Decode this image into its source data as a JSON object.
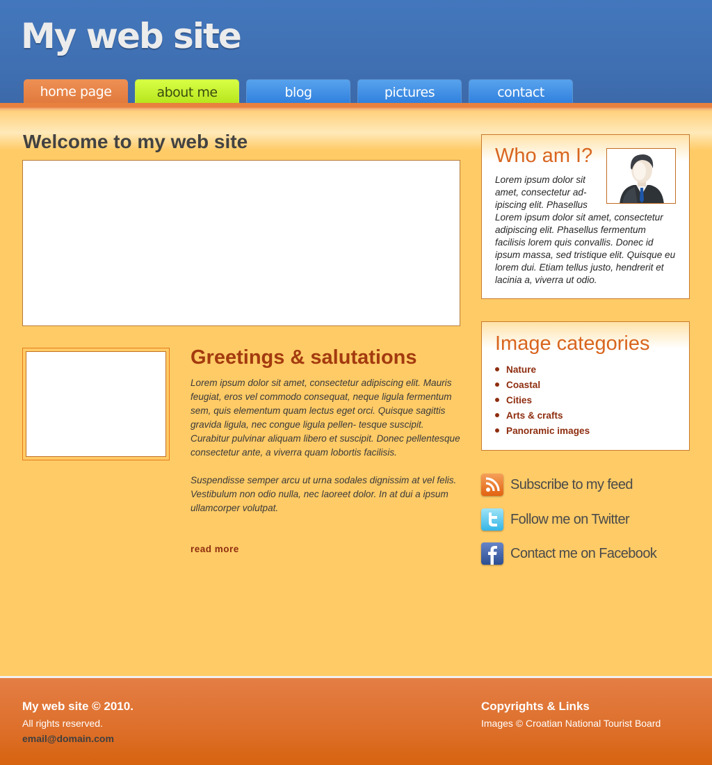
{
  "header": {
    "site_title": "My web site"
  },
  "nav": {
    "tabs": [
      {
        "label": "home page",
        "state": "active"
      },
      {
        "label": "about me"
      },
      {
        "label": "blog"
      },
      {
        "label": "pictures"
      },
      {
        "label": "contact"
      }
    ]
  },
  "main": {
    "welcome_title": "Welcome to my web site",
    "greetings": {
      "title": "Greetings & salutations",
      "paragraph1": "Lorem ipsum dolor sit amet, consectetur adipiscing elit. Mauris feugiat, eros vel commodo consequat, neque ligula fermentum sem, quis elementum quam lectus eget orci. Quisque sagittis gravida ligula, nec congue ligula pellen- tesque suscipit. Curabitur pulvinar aliquam libero et suscipit. Donec pellentesque consectetur ante, a viverra quam lobortis facilisis.",
      "paragraph2": "Suspendisse semper arcu ut urna sodales dignissim at vel felis. Vestibulum non odio nulla, nec laoreet dolor. In at dui a ipsum ullamcorper volutpat.",
      "read_more": "read more"
    }
  },
  "sidebar": {
    "who": {
      "title": "Who am I?",
      "text_narrow": "Lorem ipsum dolor sit amet, consectetur ad- ipiscing elit. Phasellus",
      "text_wide": "Lorem ipsum dolor sit amet, consectetur adipiscing elit. Phasellus fermentum facilisis lorem quis convallis. Donec id ipsum massa, sed tristique elit. Quisque eu lorem dui. Etiam tellus justo, hendrerit et lacinia a, viverra ut odio."
    },
    "categories": {
      "title": "Image categories",
      "items": [
        "Nature",
        "Coastal",
        "Cities",
        "Arts & crafts",
        "Panoramic images"
      ]
    },
    "social": [
      {
        "label": "Subscribe to my feed",
        "icon": "rss-icon"
      },
      {
        "label": "Follow me on Twitter",
        "icon": "twitter-icon"
      },
      {
        "label": "Contact me on Facebook",
        "icon": "facebook-icon"
      }
    ]
  },
  "footer": {
    "copyright": "My web site © 2010.",
    "rights": "All rights reserved.",
    "email": "email@domain.com",
    "links_title": "Copyrights & Links",
    "images_credit": "Images © Croatian National Tourist Board"
  },
  "colors": {
    "header_blue": "#4377bd",
    "page_bg": "#ffcb66",
    "accent_orange": "#e8803e",
    "heading_orange": "#d8651f",
    "link_red": "#8e2d0f",
    "tab_green": "#c6f22e",
    "tab_blue": "#3f8be5"
  }
}
